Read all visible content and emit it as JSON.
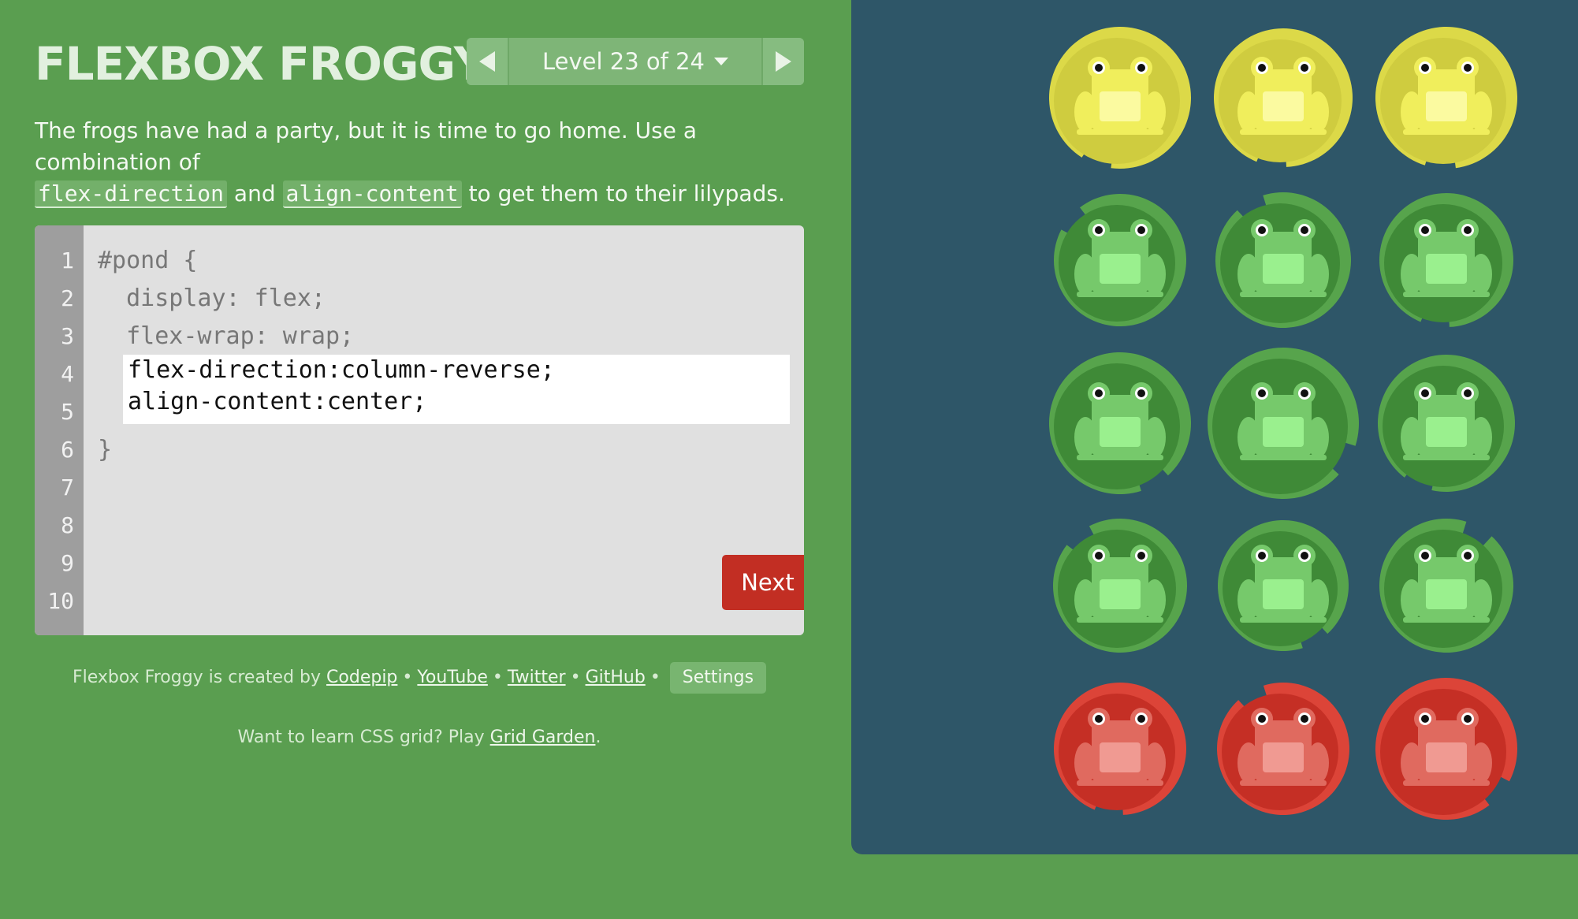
{
  "app": {
    "title": "FLEXBOX FROGGY",
    "level_label": "Level 23 of 24"
  },
  "instructions": {
    "text_before": "The frogs have had a party, but it is time to go home. Use a combination of",
    "code_1": "flex-direction",
    "text_middle": "and",
    "code_2": "align-content",
    "text_after": "to get them to their lilypads."
  },
  "editor": {
    "line_numbers": [
      "1",
      "2",
      "3",
      "4",
      "5",
      "6",
      "7",
      "8",
      "9",
      "10"
    ],
    "line_1": "#pond {",
    "line_2": "  display: flex;",
    "line_3": "  flex-wrap: wrap;",
    "line_6": "}",
    "input_value": "flex-direction:column-reverse;\nalign-content:center;",
    "next_label": "Next"
  },
  "footer": {
    "credit_text": "Flexbox Froggy is created by",
    "links": [
      "Codepip",
      "YouTube",
      "Twitter",
      "GitHub"
    ],
    "separator": "•",
    "settings_label": "Settings",
    "promo_text": "Want to learn CSS grid? Play",
    "promo_link": "Grid Garden",
    "promo_end": "."
  },
  "pond": {
    "rows": [
      [
        "yellow",
        "yellow",
        "yellow"
      ],
      [
        "green",
        "green",
        "green"
      ],
      [
        "green",
        "green",
        "green"
      ],
      [
        "green",
        "green",
        "green"
      ],
      [
        "red",
        "red",
        "red"
      ]
    ],
    "palette": {
      "yellow": {
        "pad": "#cfcc3f",
        "pad_ring": "#dcd948",
        "frog": "#f0ee5c",
        "belly": "#fbfaa0"
      },
      "green": {
        "pad": "#3f8a37",
        "pad_ring": "#57a44c",
        "frog": "#76c96b",
        "belly": "#9af08e"
      },
      "red": {
        "pad": "#c52f25",
        "pad_ring": "#dc4438",
        "frog": "#e06a5f",
        "belly": "#f09a92"
      }
    },
    "background": "#2e5668"
  }
}
